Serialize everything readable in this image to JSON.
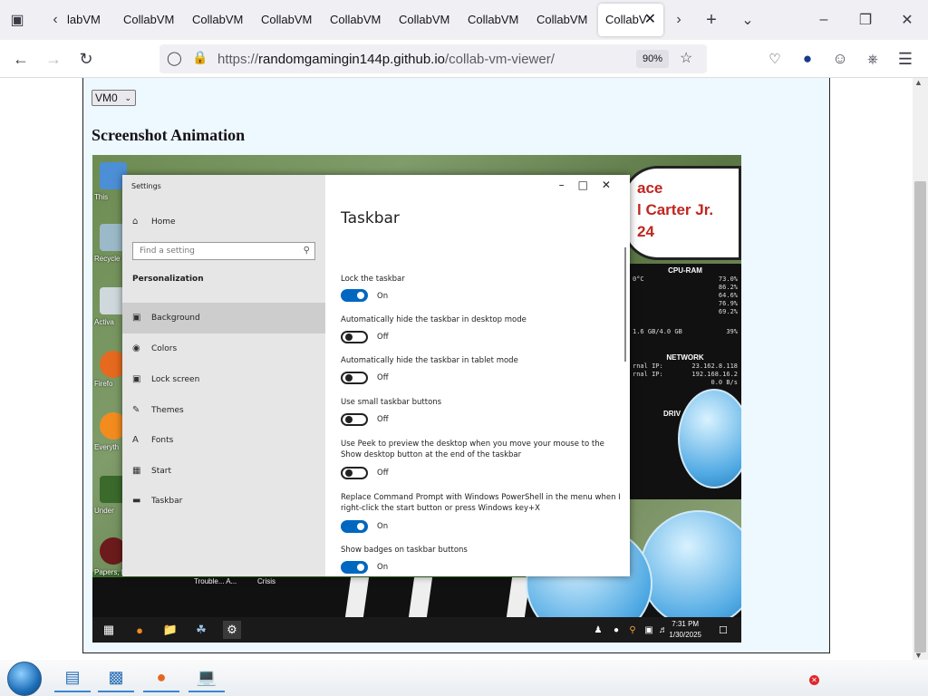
{
  "browser": {
    "tabs": [
      {
        "label": "labVM",
        "active": false
      },
      {
        "label": "CollabVM",
        "active": false
      },
      {
        "label": "CollabVM",
        "active": false
      },
      {
        "label": "CollabVM",
        "active": false
      },
      {
        "label": "CollabVM",
        "active": false
      },
      {
        "label": "CollabVM",
        "active": false
      },
      {
        "label": "CollabVM",
        "active": false
      },
      {
        "label": "CollabV",
        "active": true
      }
    ],
    "url_prefix": "https://",
    "url_host": "randomgamingin144p.github.io",
    "url_path": "/collab-vm-viewer/",
    "zoom": "90%"
  },
  "page": {
    "vm_select": "VM0",
    "heading": "Screenshot Animation"
  },
  "vm_desktop": {
    "sign_lines": [
      "ace",
      "l Carter Jr.",
      "24"
    ],
    "icon_labels": [
      "This",
      "Recycle",
      "Activa",
      "Firefo",
      "Everyth",
      "Under",
      "Papers, P"
    ],
    "monitor": {
      "cpu_ram_title": "CPU-RAM",
      "temp": "0°C",
      "cpu": "73.0%",
      "rows": [
        "86.2%",
        "64.6%",
        "76.9%",
        "69.2%"
      ],
      "mem": "1.6 GB/4.0 GB",
      "mem_pct": "39%",
      "network_title": "NETWORK",
      "ext_ip_label": "rnal IP:",
      "ext_ip": "23.162.8.118",
      "int_ip_label": "rnal IP:",
      "int_ip": "192.168.16.2",
      "speed": "0.0 B/s",
      "drive_title": "DRIV"
    },
    "taskbar_labels": [
      "Trouble... A...",
      "Crisis"
    ],
    "time": "7:31 PM",
    "date": "1/30/2025"
  },
  "settings": {
    "window_title": "Settings",
    "home": "Home",
    "find_placeholder": "Find a setting",
    "section": "Personalization",
    "nav": [
      "Background",
      "Colors",
      "Lock screen",
      "Themes",
      "Fonts",
      "Start",
      "Taskbar"
    ],
    "selected_nav": "Background",
    "page_title": "Taskbar",
    "options": [
      {
        "label": "Lock the taskbar",
        "state": "On"
      },
      {
        "label": "Automatically hide the taskbar in desktop mode",
        "state": "Off"
      },
      {
        "label": "Automatically hide the taskbar in tablet mode",
        "state": "Off"
      },
      {
        "label": "Use small taskbar buttons",
        "state": "Off"
      },
      {
        "label": "Use Peek to preview the desktop when you move your mouse to the Show desktop button at the end of the taskbar",
        "state": "Off"
      },
      {
        "label": "Replace Command Prompt with Windows PowerShell in the menu when I right-click the start button or press Windows key+X",
        "state": "On"
      },
      {
        "label": "Show badges on taskbar buttons",
        "state": "On"
      }
    ]
  },
  "colors": {
    "accent": "#0067c0",
    "frame_bg": "#eef8ff",
    "tray_error": "#e0262a"
  }
}
